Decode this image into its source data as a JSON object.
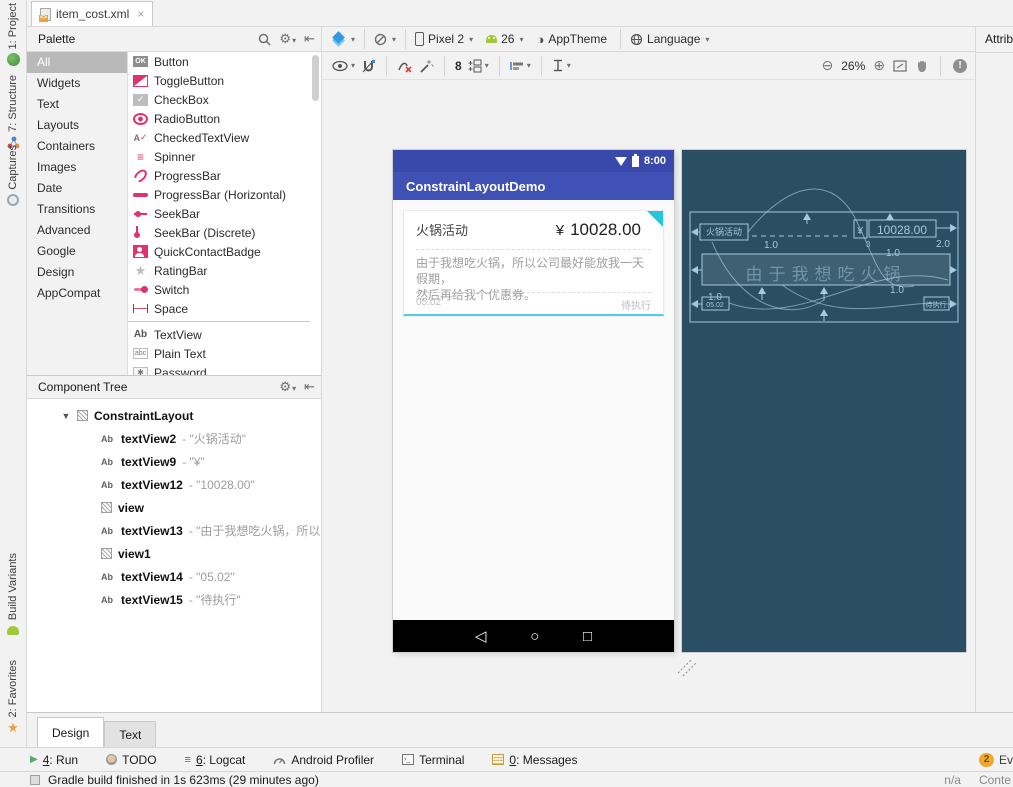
{
  "editor_tab": {
    "title": "item_cost.xml",
    "close": "×"
  },
  "stripe": {
    "top": [
      {
        "id": "project",
        "label": "1: Project"
      },
      {
        "id": "structure",
        "label": "7: Structure"
      },
      {
        "id": "captures",
        "label": "Captures"
      }
    ],
    "bottom": [
      {
        "id": "build",
        "label": "Build Variants"
      },
      {
        "id": "fav",
        "label": "2: Favorites"
      }
    ]
  },
  "palette": {
    "title": "Palette",
    "selected_category": "All",
    "categories": [
      "All",
      "Widgets",
      "Text",
      "Layouts",
      "Containers",
      "Images",
      "Date",
      "Transitions",
      "Advanced",
      "Google",
      "Design",
      "AppCompat"
    ],
    "components": [
      {
        "icon": "button",
        "name": "Button"
      },
      {
        "icon": "toggle",
        "name": "ToggleButton"
      },
      {
        "icon": "checkbox",
        "name": "CheckBox"
      },
      {
        "icon": "radio",
        "name": "RadioButton"
      },
      {
        "icon": "checkedtext",
        "name": "CheckedTextView"
      },
      {
        "icon": "spinner",
        "name": "Spinner"
      },
      {
        "icon": "progress",
        "name": "ProgressBar"
      },
      {
        "icon": "progressh",
        "name": "ProgressBar (Horizontal)"
      },
      {
        "icon": "seekbar",
        "name": "SeekBar"
      },
      {
        "icon": "seekbard",
        "name": "SeekBar (Discrete)"
      },
      {
        "icon": "contact",
        "name": "QuickContactBadge"
      },
      {
        "icon": "rating",
        "name": "RatingBar"
      },
      {
        "icon": "switch",
        "name": "Switch"
      },
      {
        "icon": "space",
        "name": "Space"
      },
      {
        "icon": "textview",
        "name": "TextView",
        "divider_before": true
      },
      {
        "icon": "plaintext",
        "name": "Plain Text"
      },
      {
        "icon": "password",
        "name": "Password"
      }
    ]
  },
  "toolbar": {
    "device": "Pixel 2",
    "api_level": "26",
    "theme": "AppTheme",
    "language": "Language",
    "default_margin": "8",
    "zoom_level": "26%"
  },
  "attributes_panel": {
    "title": "Attributes"
  },
  "component_tree": {
    "title": "Component Tree",
    "rows": [
      {
        "icon": "layout",
        "name": "ConstraintLayout",
        "root": true,
        "expander": "▼"
      },
      {
        "icon": "ab",
        "name": "textView2",
        "value": "- \"火锅活动\""
      },
      {
        "icon": "ab",
        "name": "textView9",
        "value": "- \"¥\""
      },
      {
        "icon": "ab",
        "name": "textView12",
        "value": "- \"10028.00\""
      },
      {
        "icon": "layout",
        "name": "view"
      },
      {
        "icon": "ab",
        "name": "textView13",
        "value": "- \"由于我想吃火锅，所以公司"
      },
      {
        "icon": "layout",
        "name": "view1"
      },
      {
        "icon": "ab",
        "name": "textView14",
        "value": "- \"05.02\""
      },
      {
        "icon": "ab",
        "name": "textView15",
        "value": "- \"待执行\""
      }
    ]
  },
  "phone": {
    "status_time": "8:00",
    "app_title": "ConstrainLayoutDemo",
    "card": {
      "title": "火锅活动",
      "currency": "¥",
      "price": "10028.00",
      "desc_line1": "由于我想吃火锅，所以公司最好能放我一天假期，",
      "desc_line2": "然后再给我个优惠券。",
      "date": "05.02",
      "status": "待执行"
    },
    "nav": {
      "back": "◁",
      "home": "○",
      "recents": "□"
    },
    "colors": {
      "appbar": "#3F51B5",
      "statusbar": "#3949AB",
      "accent_teal": "#26C6DA",
      "underline_teal": "#4DD0E1"
    }
  },
  "blueprint": {
    "title": "火锅活动",
    "currency": "¥",
    "price": "10028.00",
    "desc_ghost": "由于我想吃火锅",
    "date": "05.02",
    "status": "待执行",
    "margin_1a": "1.0",
    "margin_1b": "1.0",
    "margin_1c": "1.0",
    "margin_1d": "1.0",
    "margin_2": "2.0",
    "margin_3": "3",
    "colors": {
      "background": "#2A4E64",
      "line": "#A6C8E0"
    }
  },
  "bottom_tabs": {
    "tabs": [
      {
        "label": "Design",
        "active": true
      },
      {
        "label": "Text",
        "active": false
      }
    ]
  },
  "bottom_bar": {
    "items": [
      {
        "icon": "run",
        "label": "4: Run",
        "mnemonic": "4"
      },
      {
        "icon": "todo",
        "label": "TODO"
      },
      {
        "icon": "logcat",
        "label": "6: Logcat",
        "mnemonic": "6"
      },
      {
        "icon": "profiler",
        "label": "Android Profiler"
      },
      {
        "icon": "terminal",
        "label": "Terminal"
      },
      {
        "icon": "messages",
        "label": "0: Messages",
        "mnemonic": "0"
      }
    ],
    "event_badge": "2",
    "event_label": "Ev"
  },
  "status_bar": {
    "message": "Gradle build finished in 1s 623ms (29 minutes ago)",
    "right_na": "n/a",
    "right_context": "Conte"
  }
}
